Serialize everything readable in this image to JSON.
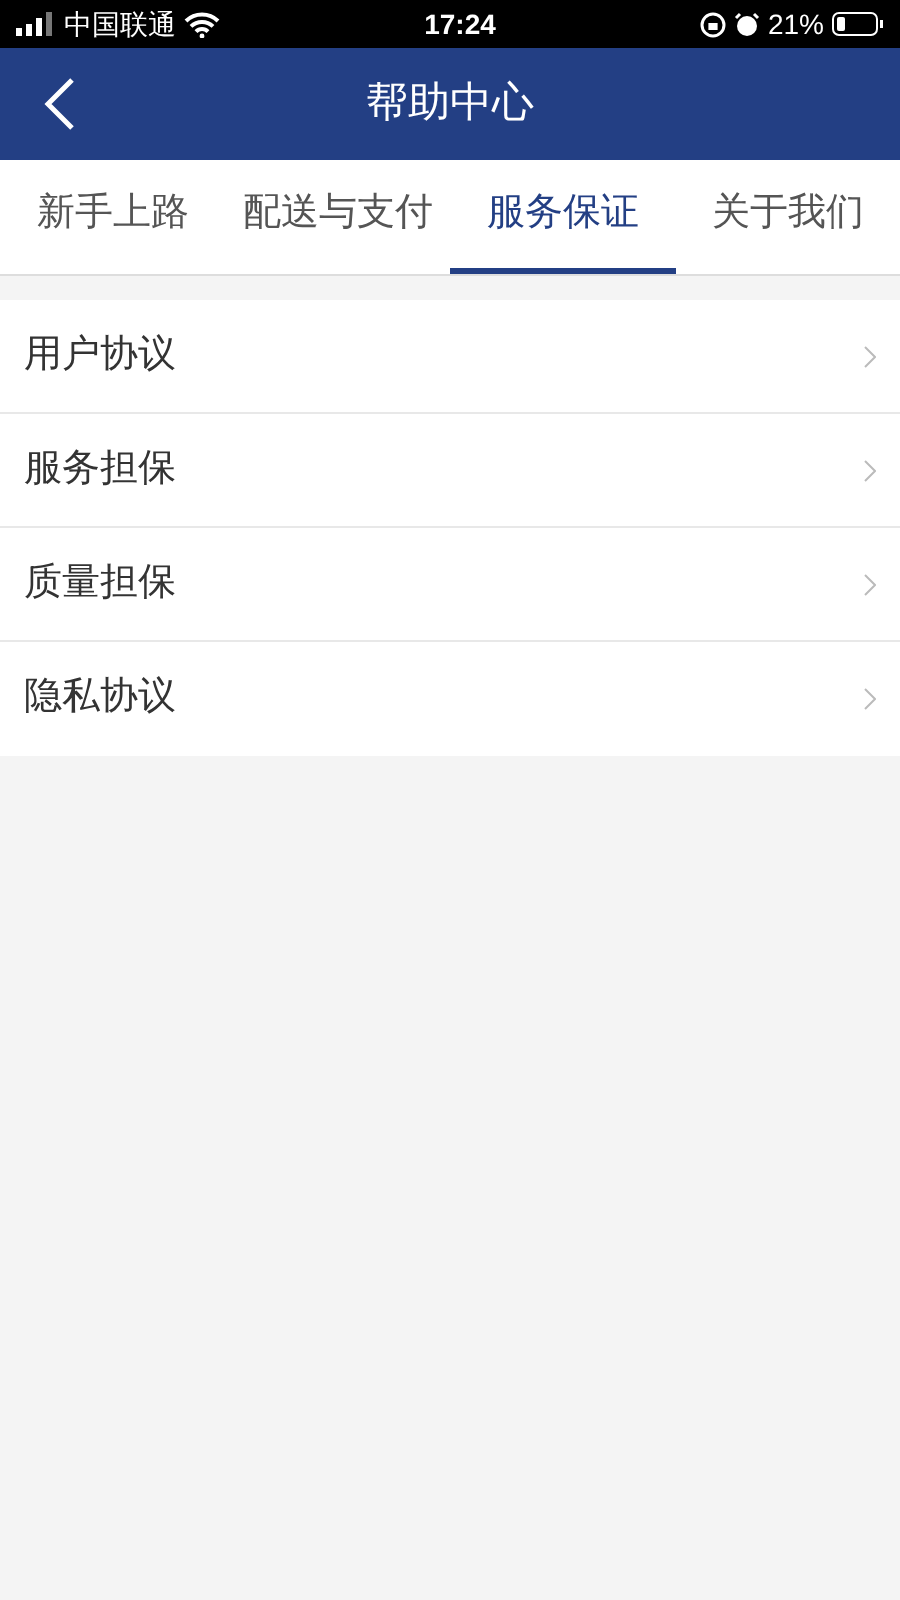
{
  "status_bar": {
    "carrier": "中国联通",
    "time": "17:24",
    "battery": "21%"
  },
  "header": {
    "title": "帮助中心"
  },
  "tabs": [
    {
      "label": "新手上路",
      "selected": false
    },
    {
      "label": "配送与支付",
      "selected": false
    },
    {
      "label": "服务保证",
      "selected": true
    },
    {
      "label": "关于我们",
      "selected": false
    }
  ],
  "items": [
    {
      "label": "用户协议"
    },
    {
      "label": "服务担保"
    },
    {
      "label": "质量担保"
    },
    {
      "label": "隐私协议"
    }
  ]
}
